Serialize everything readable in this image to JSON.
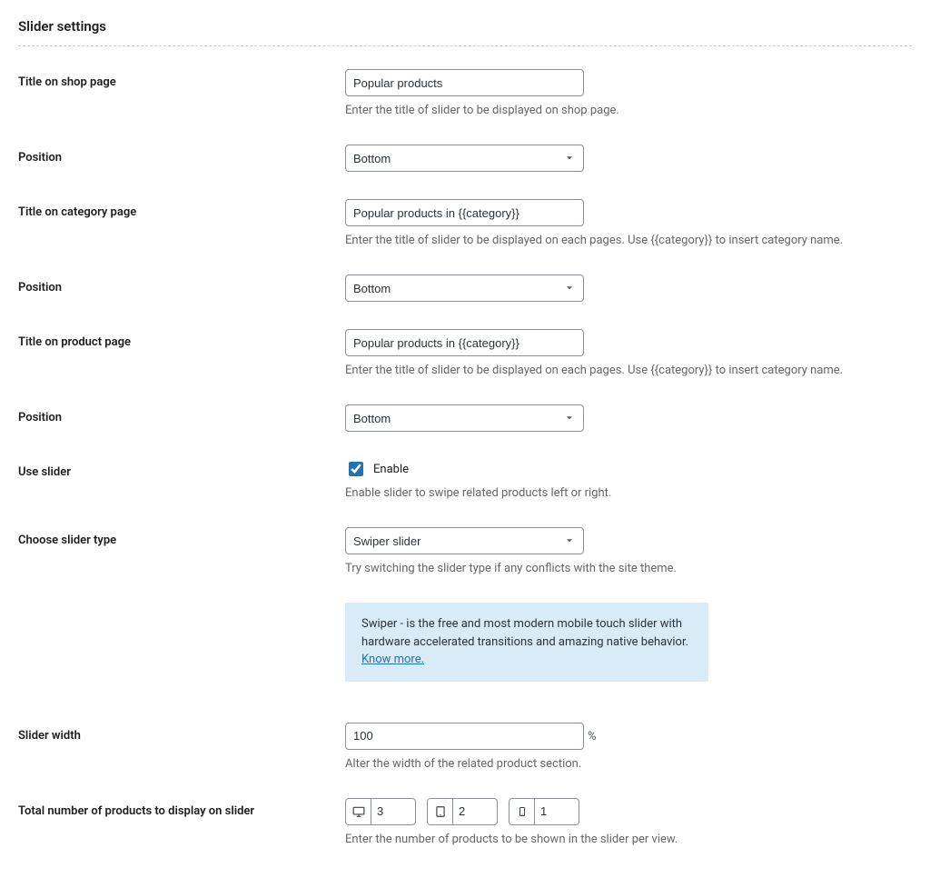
{
  "section_title": "Slider settings",
  "fields": {
    "shop_title": {
      "label": "Title on shop page",
      "value": "Popular products",
      "help": "Enter the title of slider to be displayed on shop page."
    },
    "shop_position": {
      "label": "Position",
      "value": "Bottom"
    },
    "category_title": {
      "label": "Title on category page",
      "value": "Popular products in {{category}}",
      "help": "Enter the title of slider to be displayed on each pages. Use {{category}} to insert category name."
    },
    "category_position": {
      "label": "Position",
      "value": "Bottom"
    },
    "product_title": {
      "label": "Title on product page",
      "value": "Popular products in {{category}}",
      "help": "Enter the title of slider to be displayed on each pages. Use {{category}} to insert category name."
    },
    "product_position": {
      "label": "Position",
      "value": "Bottom"
    },
    "use_slider": {
      "label": "Use slider",
      "checkbox_label": "Enable",
      "checked": true,
      "help": "Enable slider to swipe related products left or right."
    },
    "slider_type": {
      "label": "Choose slider type",
      "value": "Swiper slider",
      "help": "Try switching the slider type if any conflicts with the site theme."
    },
    "slider_notice": {
      "text": "Swiper - is the free and most modern mobile touch slider with hardware accelerated transitions and amazing native behavior. ",
      "link_text": "Know more."
    },
    "slider_width": {
      "label": "Slider width",
      "value": "100",
      "suffix": "%",
      "help": "Alter the width of the related product section."
    },
    "products_count": {
      "label": "Total number of products to display on slider",
      "desktop": "3",
      "tablet": "2",
      "mobile": "1",
      "help": "Enter the number of products to be shown in the slider per view."
    }
  }
}
